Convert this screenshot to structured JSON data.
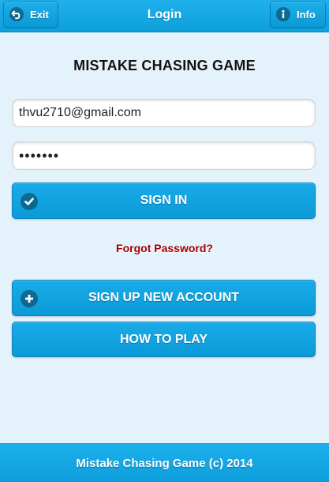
{
  "header": {
    "title": "Login",
    "exit_label": "Exit",
    "exit_icon": "back-arrow-icon",
    "info_label": "Info",
    "info_icon": "info-icon"
  },
  "main": {
    "heading": "MISTAKE CHASING GAME",
    "email_value": "thvu2710@gmail.com",
    "password_mask": "•••••••",
    "signin_label": "SIGN IN",
    "signin_icon": "check-icon",
    "forgot_label": "Forgot Password?",
    "signup_label": "SIGN UP NEW ACCOUNT",
    "signup_icon": "plus-icon",
    "howto_label": "HOW TO PLAY"
  },
  "footer": {
    "text": "Mistake Chasing Game (c) 2014"
  },
  "colors": {
    "accent": "#0d9fdc",
    "background": "#e4f2fc",
    "link": "#a60000"
  }
}
